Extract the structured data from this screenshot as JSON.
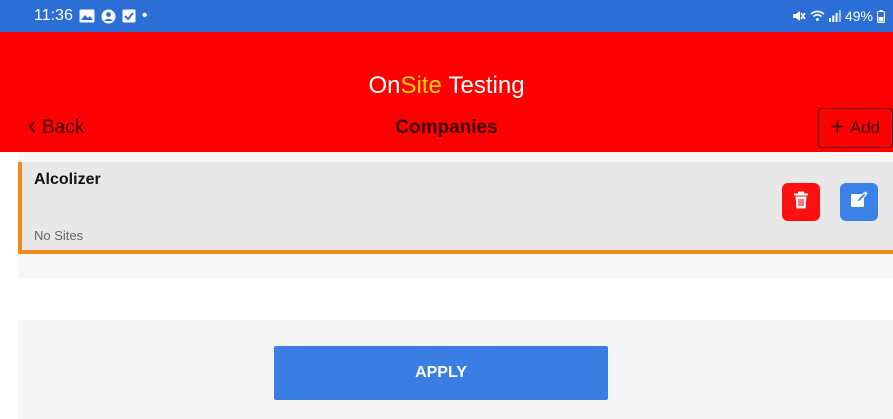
{
  "status_bar": {
    "time": "11:36",
    "left_icons": [
      "image-icon",
      "account-icon",
      "checkbox-icon"
    ],
    "dot": "•",
    "battery": "49%",
    "right_icons": [
      "mute-icon",
      "wifi-icon",
      "signal-icon",
      "battery-icon"
    ]
  },
  "header": {
    "brand": {
      "part1": "On",
      "part2": "Site",
      "part3": "Testing"
    },
    "back_label": "Back",
    "title": "Companies",
    "add_label": "Add"
  },
  "companies": [
    {
      "name": "Alcolizer",
      "sites": "No Sites"
    }
  ],
  "apply_label": "APPLY",
  "colors": {
    "status_bar": "#2b6ed6",
    "header": "#ff0000",
    "brand_accent": "#ffd400",
    "card_border": "#f08a1a",
    "delete": "#ff1010",
    "edit": "#3b82e8",
    "apply": "#3a7de3"
  }
}
